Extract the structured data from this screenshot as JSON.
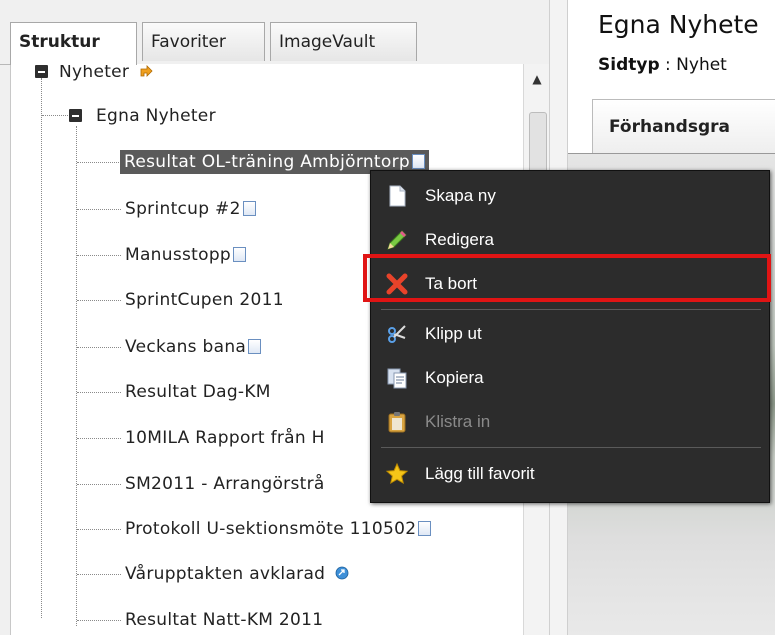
{
  "tabs": [
    "Struktur",
    "Favoriter",
    "ImageVault"
  ],
  "tree": {
    "root": "Nyheter",
    "folder": "Egna Nyheter",
    "items": [
      "Resultat OL-träning Ambjörntorp",
      "Sprintcup #2",
      "Manusstopp",
      "SprintCupen 2011",
      "Veckans bana",
      "Resultat Dag-KM",
      "10MILA Rapport från H",
      "SM2011 - Arrangörstrå",
      "Protokoll U-sektionsmöte 110502",
      "Vårupptakten avklarad",
      "Resultat Natt-KM 2011"
    ],
    "selected_index": 0
  },
  "right": {
    "title": "Egna Nyhete",
    "pagetype_label": "Sidtyp",
    "pagetype_value": " : Nyhet",
    "preview_tab": "Förhandsgra"
  },
  "menu": {
    "items": [
      {
        "label": "Skapa ny",
        "icon": "new-page-icon",
        "enabled": true
      },
      {
        "label": "Redigera",
        "icon": "pencil-icon",
        "enabled": true
      },
      {
        "label": "Ta bort",
        "icon": "delete-x-icon",
        "enabled": true
      },
      {
        "label": "Klipp ut",
        "icon": "scissors-icon",
        "enabled": true
      },
      {
        "label": "Kopiera",
        "icon": "copy-icon",
        "enabled": true
      },
      {
        "label": "Klistra in",
        "icon": "clipboard-icon",
        "enabled": false
      },
      {
        "label": "Lägg till favorit",
        "icon": "star-icon",
        "enabled": true
      }
    ]
  },
  "colors": {
    "menu_bg": "#2c2c2c",
    "highlight": "#e01414",
    "selection": "#5a5a5a"
  }
}
